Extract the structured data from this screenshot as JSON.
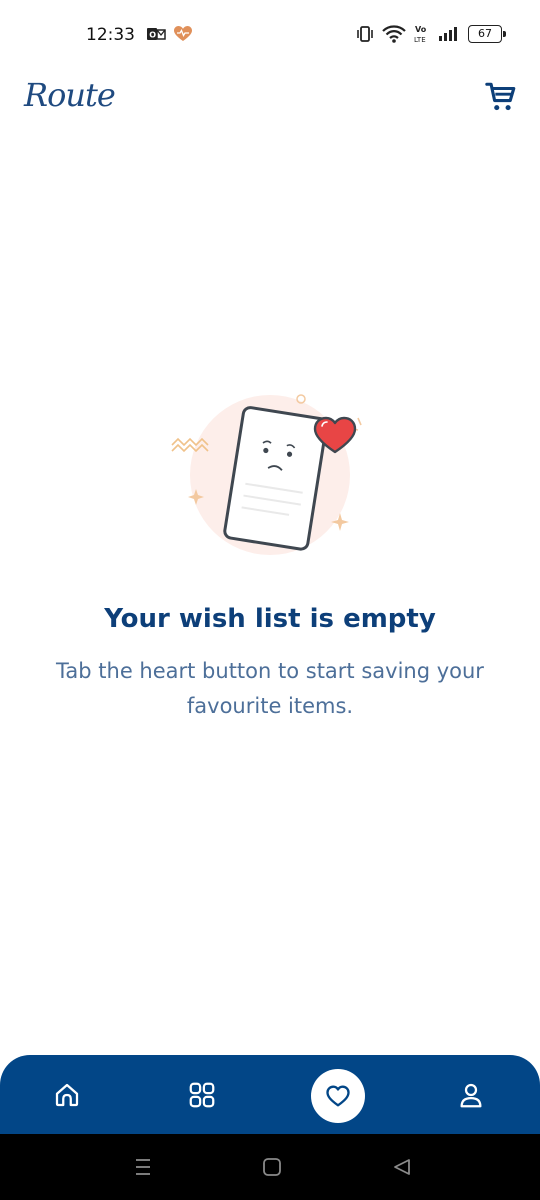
{
  "status_bar": {
    "time": "12:33",
    "battery": "67",
    "volte": "Vo LTE"
  },
  "header": {
    "logo_text": "Route"
  },
  "empty_state": {
    "title": "Your wish list is empty",
    "subtitle_line1": "Tab the heart button to start saving your",
    "subtitle_line2": "favourite items."
  },
  "bottom_nav": {
    "items": [
      {
        "icon": "home-icon"
      },
      {
        "icon": "grid-icon"
      },
      {
        "icon": "heart-icon"
      },
      {
        "icon": "user-icon"
      }
    ],
    "active_index": 2
  },
  "colors": {
    "primary": "#024687",
    "title": "#0d3f79",
    "subtitle": "#4d6f99",
    "heart": "#e84545"
  }
}
